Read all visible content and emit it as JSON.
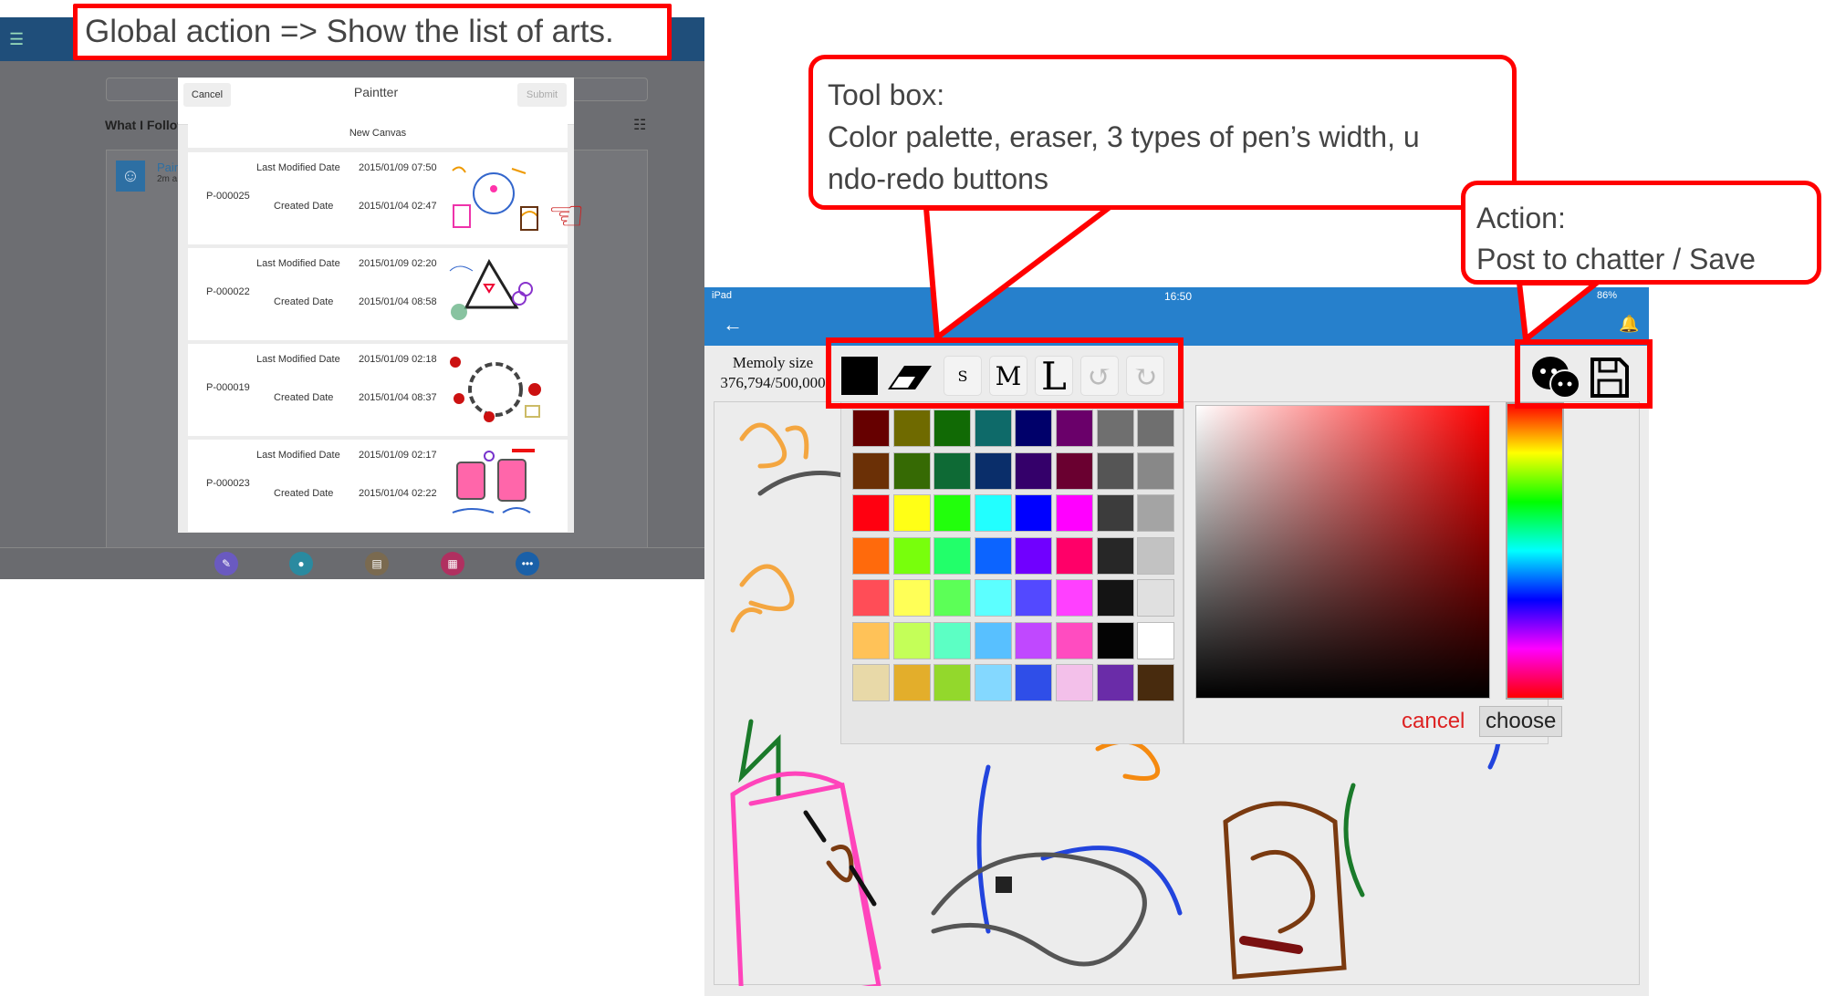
{
  "annotations": {
    "global_action": "Global action => Show the list of arts.",
    "toolbox_title": "Tool box:",
    "toolbox_desc_1": "Color palette, eraser, 3 types of pen’s width, u",
    "toolbox_desc_2": "ndo-redo buttons",
    "action_title": "Action:",
    "action_desc": "Post to chatter / Save"
  },
  "feed": {
    "header": "What I Follow",
    "post_name": "Pain",
    "post_time": "2m a"
  },
  "modal": {
    "cancel": "Cancel",
    "title": "Paintter",
    "submit": "Submit",
    "new_canvas": "New Canvas",
    "rows": [
      {
        "id": "P-000025",
        "last_modified_label": "Last Modified Date",
        "last_modified": "2015/01/09 07:50",
        "created_label": "Created Date",
        "created": "2015/01/04 02:47"
      },
      {
        "id": "P-000022",
        "last_modified_label": "Last Modified Date",
        "last_modified": "2015/01/09 02:20",
        "created_label": "Created Date",
        "created": "2015/01/04 08:58"
      },
      {
        "id": "P-000019",
        "last_modified_label": "Last Modified Date",
        "last_modified": "2015/01/09 02:18",
        "created_label": "Created Date",
        "created": "2015/01/04 08:37"
      },
      {
        "id": "P-000023",
        "last_modified_label": "Last Modified Date",
        "last_modified": "2015/01/09 02:17",
        "created_label": "Created Date",
        "created": "2015/01/04 02:22"
      }
    ]
  },
  "ipad": {
    "device": "iPad",
    "time": "16:50",
    "battery": "86%",
    "memory_label": "Memoly size",
    "memory_value": "376,794/500,000",
    "pen_s": "S",
    "pen_m": "M",
    "pen_l": "L",
    "cancel": "cancel",
    "choose": "choose",
    "selected_color": "#000000"
  },
  "palette": [
    [
      "#660000",
      "#6f6a00",
      "#116a05",
      "#0e6a69",
      "#00006a",
      "#6a006a",
      "#6f6f6f",
      "#6f6f6f"
    ],
    [
      "#6b3006",
      "#366a04",
      "#0e6a35",
      "#0a2e6a",
      "#34006a",
      "#6a0030",
      "#555555",
      "#888888"
    ],
    [
      "#ff0010",
      "#ffff16",
      "#22ff0c",
      "#22ffff",
      "#0000ff",
      "#ff00ff",
      "#3c3c3c",
      "#a4a4a4"
    ],
    [
      "#ff6a0c",
      "#78ff0c",
      "#22ff6a",
      "#0c64ff",
      "#7000ff",
      "#ff0068",
      "#272727",
      "#c2c2c2"
    ],
    [
      "#ff4d57",
      "#ffff57",
      "#5cff57",
      "#5cffff",
      "#5349ff",
      "#ff40ff",
      "#141414",
      "#e0e0e0"
    ],
    [
      "#ffc258",
      "#c4ff58",
      "#5cffc4",
      "#58c0ff",
      "#c048ff",
      "#ff4cc0",
      "#040404",
      "#ffffff"
    ],
    [
      "#e8d9a8",
      "#e3ae2b",
      "#93d82c",
      "#84d8ff",
      "#2f4ee8",
      "#f3c0ea",
      "#6a2ca8",
      "#482b0e"
    ]
  ]
}
